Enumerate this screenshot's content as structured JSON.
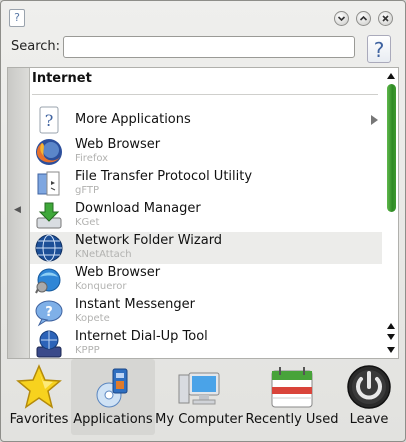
{
  "window": {
    "app_icon_glyph": "?",
    "buttons": [
      "minimize-icon",
      "maximize-icon",
      "close-icon"
    ]
  },
  "search": {
    "label": "Search:",
    "value": "",
    "placeholder": "",
    "help_glyph": "?"
  },
  "panel": {
    "section_title": "Internet",
    "back_glyph": "◀",
    "items": [
      {
        "name": "More Applications",
        "subtitle": "",
        "icon": "help-icon",
        "has_submenu": true
      },
      {
        "name": "Web Browser",
        "subtitle": "Firefox",
        "icon": "firefox-icon",
        "has_submenu": false
      },
      {
        "name": "File Transfer Protocol Utility",
        "subtitle": "gFTP",
        "icon": "gftp-icon",
        "has_submenu": false
      },
      {
        "name": "Download Manager",
        "subtitle": "KGet",
        "icon": "kget-icon",
        "has_submenu": false
      },
      {
        "name": "Network Folder Wizard",
        "subtitle": "KNetAttach",
        "icon": "globe-icon",
        "has_submenu": false
      },
      {
        "name": "Web Browser",
        "subtitle": "Konqueror",
        "icon": "konqueror-icon",
        "has_submenu": false
      },
      {
        "name": "Instant Messenger",
        "subtitle": "Kopete",
        "icon": "kopete-icon",
        "has_submenu": false
      },
      {
        "name": "Internet Dial-Up Tool",
        "subtitle": "KPPP",
        "icon": "kppp-icon",
        "has_submenu": false
      }
    ]
  },
  "tabs": [
    {
      "label": "Favorites",
      "icon": "star-icon",
      "active": false
    },
    {
      "label": "Applications",
      "icon": "applications-icon",
      "active": true
    },
    {
      "label": "My Computer",
      "icon": "computer-icon",
      "active": false
    },
    {
      "label": "Recently Used",
      "icon": "calendar-icon",
      "active": false
    },
    {
      "label": "Leave",
      "icon": "power-icon",
      "active": false
    }
  ],
  "colors": {
    "scroll_thumb": "#3e9b30",
    "accent_blue": "#3f63a0",
    "subtitle_gray": "#b2b2b0"
  }
}
